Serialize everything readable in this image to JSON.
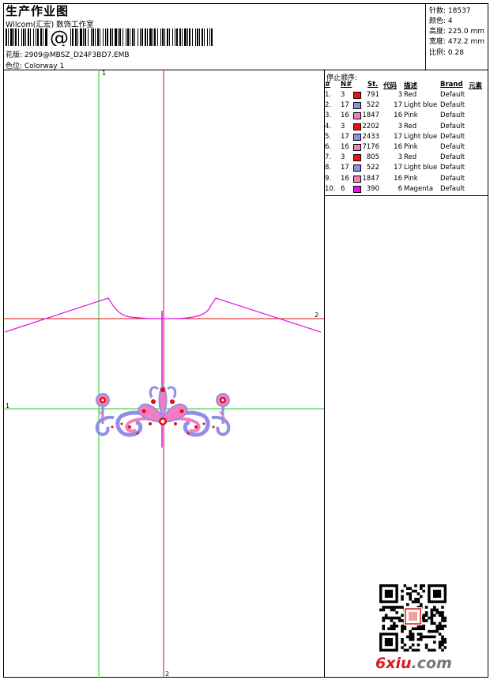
{
  "header": {
    "title": "生产作业图",
    "company": "Wilcom(汇宏) 数饰工作室",
    "design_label": "花版:",
    "design_value": "2909@MBSZ_D24F3BD7.EMB",
    "colorway_label": "色位:",
    "colorway_value": "Colorway 1"
  },
  "stats": {
    "stitches": "针数: 18537",
    "colors": "颜色: 4",
    "height": "高度: 225.0 mm",
    "width": "宽度: 472.2 mm",
    "scale": "比例: 0.28"
  },
  "sequence": {
    "title": "停止顺序:",
    "headers": {
      "idx": "#",
      "needle": "N#",
      "stitches": "St.",
      "code": "代码",
      "desc": "描述",
      "brand": "Brand",
      "element": "元素"
    },
    "rows": [
      {
        "idx": "1.",
        "needle": "3",
        "color": "#ee1111",
        "stitches": "791",
        "code": "3",
        "desc": "Red",
        "brand": "Default"
      },
      {
        "idx": "2.",
        "needle": "17",
        "color": "#8f8fe6",
        "stitches": "522",
        "code": "17",
        "desc": "Light blue",
        "brand": "Default"
      },
      {
        "idx": "3.",
        "needle": "16",
        "color": "#f47fc0",
        "stitches": "1847",
        "code": "16",
        "desc": "Pink",
        "brand": "Default"
      },
      {
        "idx": "4.",
        "needle": "3",
        "color": "#ee1111",
        "stitches": "2202",
        "code": "3",
        "desc": "Red",
        "brand": "Default"
      },
      {
        "idx": "5.",
        "needle": "17",
        "color": "#8f8fe6",
        "stitches": "2433",
        "code": "17",
        "desc": "Light blue",
        "brand": "Default"
      },
      {
        "idx": "6.",
        "needle": "16",
        "color": "#f47fc0",
        "stitches": "7176",
        "code": "16",
        "desc": "Pink",
        "brand": "Default"
      },
      {
        "idx": "7.",
        "needle": "3",
        "color": "#ee1111",
        "stitches": "805",
        "code": "3",
        "desc": "Red",
        "brand": "Default"
      },
      {
        "idx": "8.",
        "needle": "17",
        "color": "#8f8fe6",
        "stitches": "522",
        "code": "17",
        "desc": "Light blue",
        "brand": "Default"
      },
      {
        "idx": "9.",
        "needle": "16",
        "color": "#f47fc0",
        "stitches": "1847",
        "code": "16",
        "desc": "Pink",
        "brand": "Default"
      },
      {
        "idx": "10.",
        "needle": "6",
        "color": "#e014e0",
        "stitches": "390",
        "code": "6",
        "desc": "Magenta",
        "brand": "Default"
      }
    ]
  },
  "canvas": {
    "axis_labels": {
      "green_v": "1",
      "green_h": "1",
      "red_h": "2",
      "red_v": "2"
    },
    "colors": {
      "green": "#22cc22",
      "red": "#dd1111",
      "magenta": "#e014e0",
      "pink": "#f47fc0",
      "blue": "#8f8fe6"
    }
  },
  "watermark": {
    "main": "6xiu",
    "tld": ".com"
  }
}
